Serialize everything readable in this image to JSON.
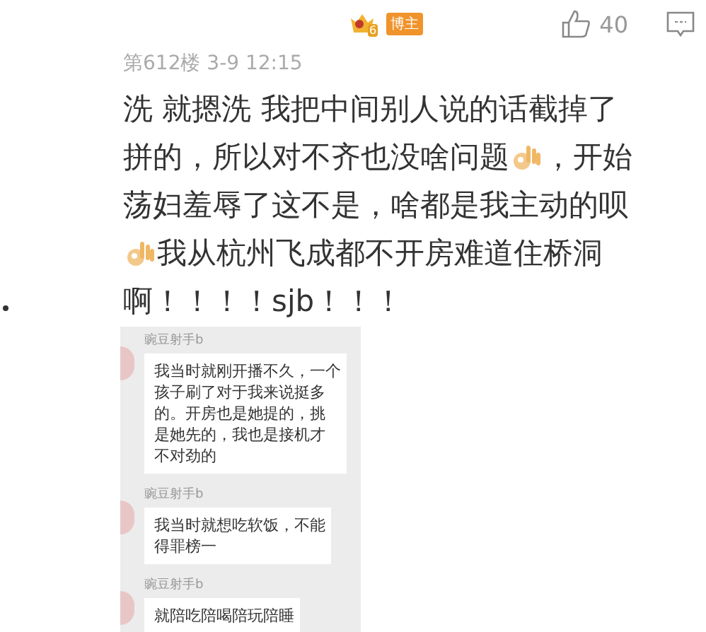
{
  "header": {
    "vip_level": "6",
    "role_tag": "博主",
    "likes": "40"
  },
  "meta": "第612楼 3-9 12:15",
  "body_lines": [
    [
      {
        "kind": "text",
        "text": "洗 就摁洗 我把中间别人说的话截掉了"
      }
    ],
    [
      {
        "kind": "text",
        "text": "拼的，所以对不齐也没啥问题"
      },
      {
        "kind": "emoji"
      },
      {
        "kind": "text",
        "text": "，开始"
      }
    ],
    [
      {
        "kind": "text",
        "text": "荡妇羞辱了这不是，啥都是我主动的呗"
      }
    ],
    [
      {
        "kind": "emoji"
      },
      {
        "kind": "text",
        "text": "我从杭州飞成都不开房难道住桥洞"
      }
    ],
    [
      {
        "kind": "text",
        "text": "啊！！！！sjb！！！"
      }
    ]
  ],
  "chat": {
    "messages": [
      {
        "sender": "豌豆射手b",
        "lines": [
          "我当时就刚开播不久，一个",
          "孩子刷了对于我来说挺多",
          "的。开房也是她提的，挑",
          "是她先的，我也是接机才",
          "不对劲的"
        ]
      },
      {
        "sender": "豌豆射手b",
        "lines": [
          "我当时就想吃软饭，不能",
          "得罪榜一"
        ]
      },
      {
        "sender": "豌豆射手b",
        "lines": [
          "就陪吃陪喝陪玩陪睡"
        ]
      }
    ]
  }
}
